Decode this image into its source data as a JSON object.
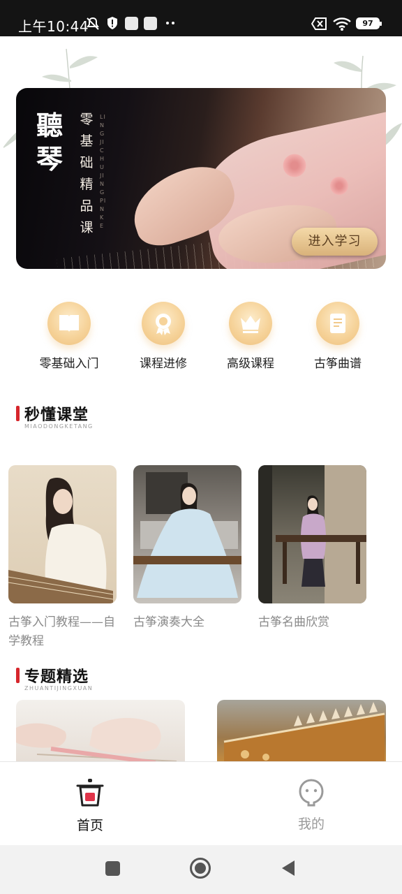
{
  "status_bar": {
    "time": "上午10:44",
    "battery": "97",
    "icons": [
      "mute-icon",
      "alert-shield-icon",
      "app-square-icon",
      "app-square-icon",
      "more-dots-icon",
      "no-sim-icon",
      "wifi-icon",
      "battery-icon"
    ]
  },
  "banner": {
    "brand_big": "聽琴",
    "brand_sub": "零基础精品课",
    "pinyin": "LING JI CHU JING PIN KE",
    "cta": "进入学习"
  },
  "categories": [
    {
      "label": "零基础入门",
      "icon": "book-icon"
    },
    {
      "label": "课程进修",
      "icon": "badge-medal-icon"
    },
    {
      "label": "高级课程",
      "icon": "crown-icon"
    },
    {
      "label": "古筝曲谱",
      "icon": "sheet-music-icon"
    }
  ],
  "sections": {
    "quick": {
      "title": "秒懂课堂",
      "subtitle": "MIAODONGKETANG"
    },
    "topics": {
      "title": "专题精选",
      "subtitle": "ZHUANTIJINGXUAN"
    }
  },
  "courses": [
    {
      "title": "古筝入门教程——自学教程"
    },
    {
      "title": "古筝演奏大全"
    },
    {
      "title": "古筝名曲欣赏"
    }
  ],
  "tabbar": {
    "home": "首页",
    "mine": "我的"
  },
  "colors": {
    "accent_red": "#d6262c",
    "gold": "#eec07c",
    "status_bar": "#141414"
  }
}
